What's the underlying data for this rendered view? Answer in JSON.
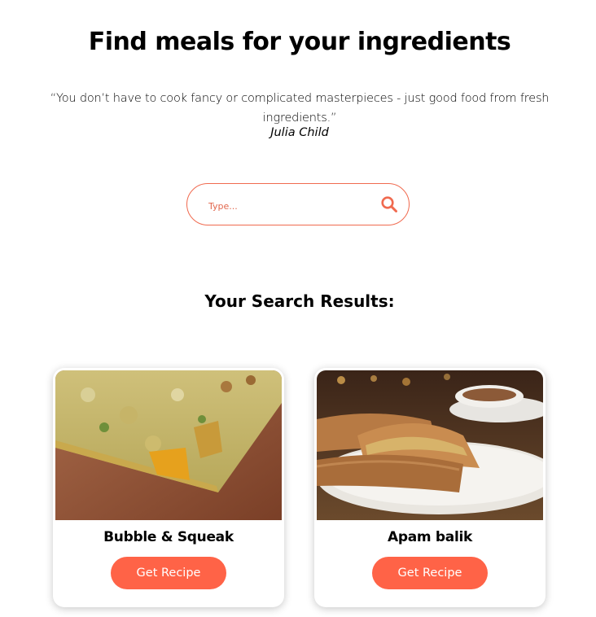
{
  "header": {
    "title": "Find meals for your ingredients",
    "quote": "“You don’t have to cook fancy or complicated masterpieces - just good food from fresh ingredients.”",
    "quote_author": "Julia Child"
  },
  "search": {
    "placeholder": "Type...",
    "value": "",
    "icon": "search-icon",
    "accent_color": "#f06a4f"
  },
  "results": {
    "heading": "Your Search Results:",
    "items": [
      {
        "title": "Bubble & Squeak",
        "button_label": "Get Recipe"
      },
      {
        "title": "Apam balik",
        "button_label": "Get Recipe"
      }
    ]
  },
  "colors": {
    "button": "#ff6347",
    "text": "#000000"
  }
}
